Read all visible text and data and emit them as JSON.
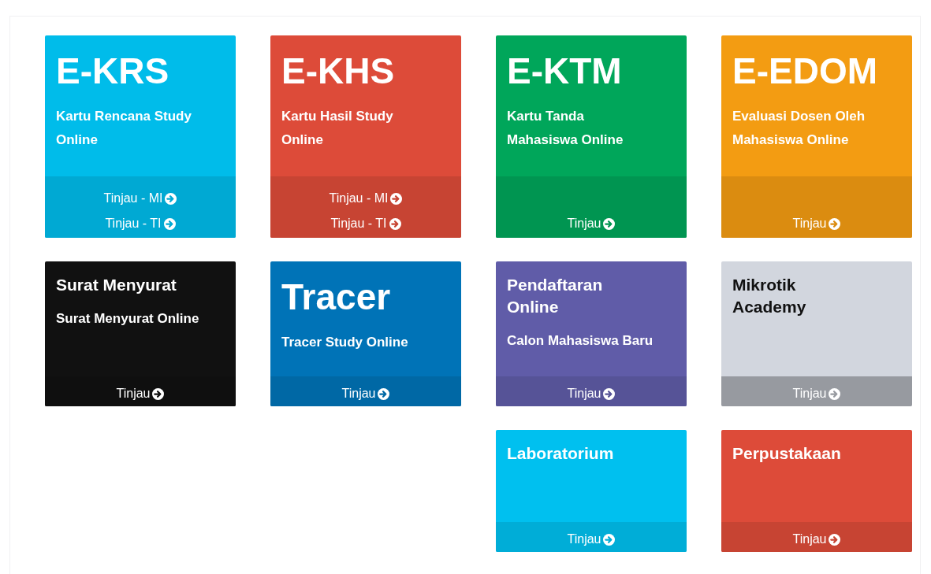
{
  "columns": [
    {
      "cards": [
        {
          "title": "E-KRS",
          "kind": "big",
          "subtitle": "Kartu Rencana Study Online",
          "color": "#00bcea",
          "links": [
            "Tinjau - MI",
            "Tinjau - TI"
          ]
        },
        {
          "title": "Surat Menyurat",
          "kind": "small",
          "subtitle": "Surat Menyurat Online",
          "color": "#111111",
          "links": [
            "Tinjau"
          ]
        }
      ]
    },
    {
      "cards": [
        {
          "title": "E-KHS",
          "kind": "big",
          "subtitle": "Kartu Hasil Study Online",
          "color": "#dd4b39",
          "links": [
            "Tinjau - MI",
            "Tinjau - TI"
          ]
        },
        {
          "title": "Tracer",
          "kind": "big",
          "subtitle": "Tracer Study Online",
          "color": "#0073b7",
          "links": [
            "Tinjau"
          ]
        }
      ]
    },
    {
      "cards": [
        {
          "title": "E-KTM",
          "kind": "big",
          "subtitle": "Kartu Tanda Mahasiswa Online",
          "color": "#00a65a",
          "links": [
            "Tinjau"
          ]
        },
        {
          "title": "Pendaftaran Online",
          "kind": "small",
          "subtitle": "Calon Mahasiswa Baru",
          "color": "#605ca8",
          "links": [
            "Tinjau"
          ]
        },
        {
          "title": "Laboratorium",
          "kind": "small",
          "color": "#00c0ef",
          "links": [
            "Tinjau"
          ]
        }
      ]
    },
    {
      "cards": [
        {
          "title": "E-EDOM",
          "kind": "big",
          "subtitle": "Evaluasi Dosen Oleh Mahasiswa Online",
          "color": "#f39c12",
          "links": [
            "Tinjau"
          ]
        },
        {
          "title": "Mikrotik Academy",
          "kind": "muted",
          "color": "#d2d6de",
          "links": [
            "Tinjau"
          ]
        },
        {
          "title": "Perpustakaan",
          "kind": "small",
          "color": "#dd4b39",
          "links": [
            "Tinjau"
          ]
        }
      ]
    }
  ]
}
